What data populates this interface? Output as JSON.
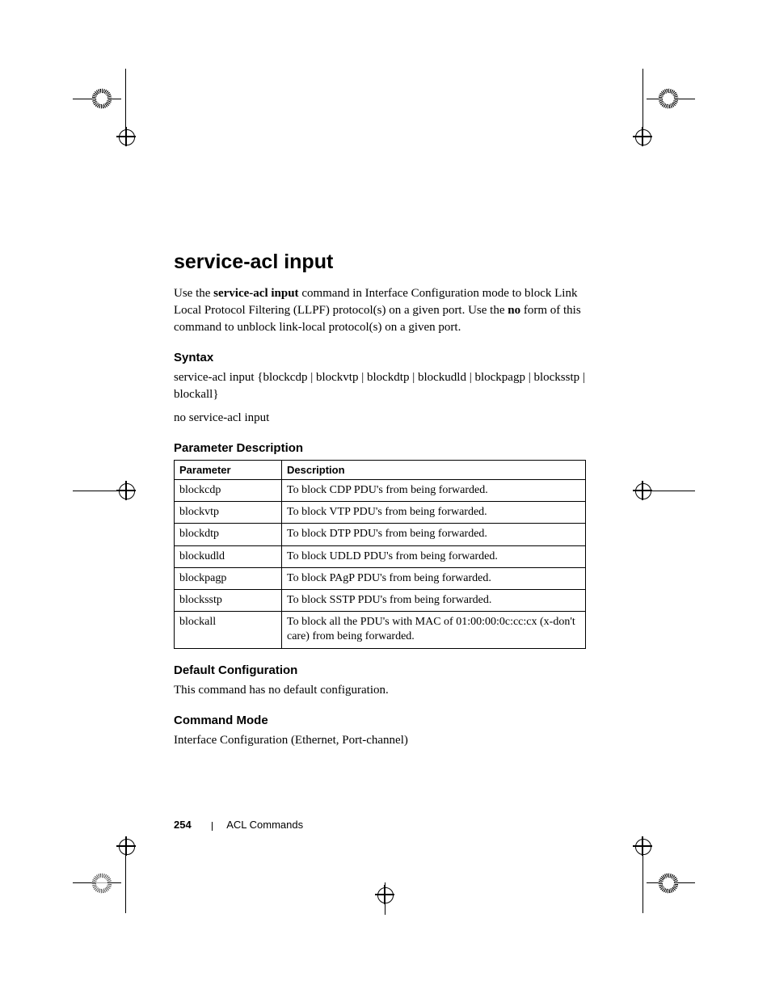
{
  "heading": "service-acl input",
  "intro_parts": {
    "p1": "Use the ",
    "bold1": "service-acl input",
    "p2": " command in Interface Configuration mode to block Link Local Protocol Filtering (LLPF) protocol(s) on a given port. Use the ",
    "bold2": "no",
    "p3": " form of this command to unblock link-local protocol(s) on a given port."
  },
  "syntax": {
    "title": "Syntax",
    "line1": "service-acl input {blockcdp | blockvtp | blockdtp | blockudld | blockpagp | blocksstp | blockall}",
    "line2": "no service-acl input"
  },
  "param_desc": {
    "title": "Parameter Description",
    "headers": {
      "c1": "Parameter",
      "c2": "Description"
    },
    "rows": [
      {
        "p": "blockcdp",
        "d": "To block CDP PDU's from being forwarded."
      },
      {
        "p": "blockvtp",
        "d": "To block VTP PDU's from being forwarded."
      },
      {
        "p": "blockdtp",
        "d": "To block DTP PDU's from being forwarded."
      },
      {
        "p": "blockudld",
        "d": "To block UDLD PDU's from being forwarded."
      },
      {
        "p": "blockpagp",
        "d": "To block PAgP PDU's from being forwarded."
      },
      {
        "p": "blocksstp",
        "d": "To block SSTP PDU's from being forwarded."
      },
      {
        "p": "blockall",
        "d": "To block all the PDU's with MAC of 01:00:00:0c:cc:cx (x-don't care) from being forwarded."
      }
    ]
  },
  "default_cfg": {
    "title": "Default Configuration",
    "text": "This command has no default configuration."
  },
  "cmd_mode": {
    "title": "Command Mode",
    "text": "Interface Configuration (Ethernet, Port-channel)"
  },
  "footer": {
    "page": "254",
    "section": "ACL Commands"
  }
}
